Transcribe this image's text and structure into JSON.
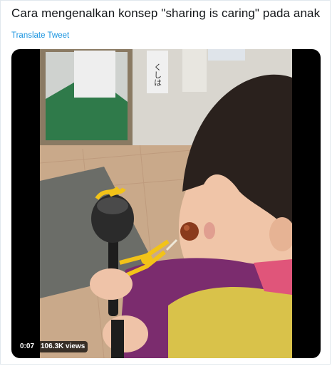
{
  "tweet": {
    "text": "Cara mengenalkan konsep \"sharing is caring\" pada anak",
    "translate_label": "Translate Tweet"
  },
  "video": {
    "duration": "0:07",
    "views": "106.3K views",
    "sign_text": "くしは"
  },
  "colors": {
    "link": "#1b95e0",
    "text": "#14171a",
    "jacket_purple": "#7b2c6e",
    "jacket_yellow": "#d9c24a",
    "toy_yellow": "#f2c318",
    "floor": "#c9a98a",
    "mat": "#6b6d68",
    "green_mat": "#2f7a4a"
  }
}
